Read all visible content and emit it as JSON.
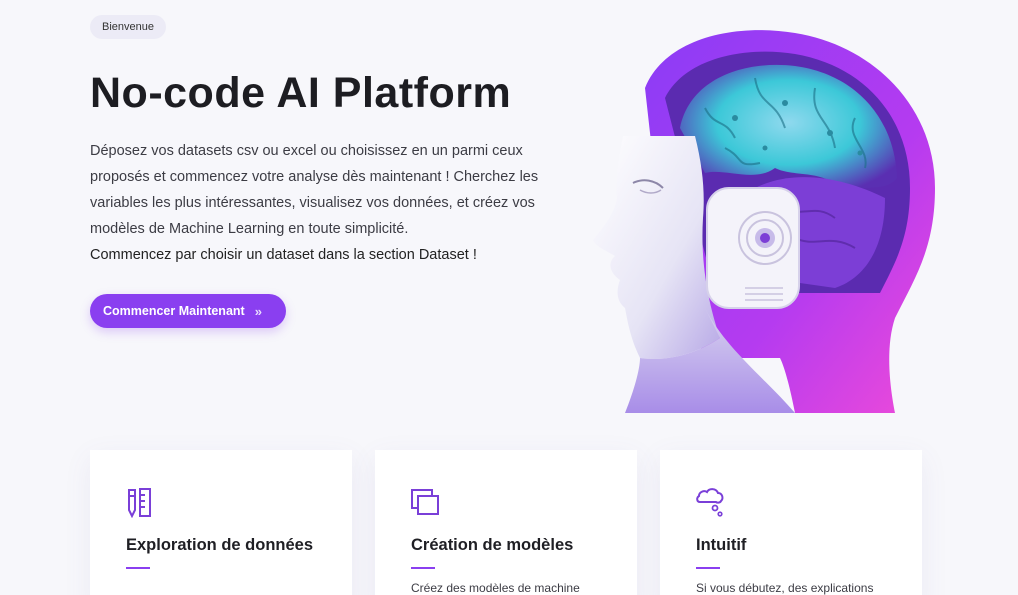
{
  "hero": {
    "badge": "Bienvenue",
    "title": "No-code AI Platform",
    "description": "Déposez vos datasets csv ou excel ou choisissez en un parmi ceux proposés et commencez votre analyse dès maintenant ! Cherchez les variables les plus intéressantes, visualisez vos données, et créez vos modèles de Machine Learning en toute simplicité.",
    "call_to_action_text": "Commencez par choisir un dataset dans la section Dataset !",
    "button_label": "Commencer Maintenant",
    "button_icon": "double-chevron-right-icon",
    "illustration": "ai-head-illustration"
  },
  "features": [
    {
      "title": "Exploration de données",
      "text": "",
      "icon": "ruler-pencil-icon"
    },
    {
      "title": "Création de modèles",
      "text": "Créez des modèles de machine",
      "icon": "stacked-squares-icon"
    },
    {
      "title": "Intuitif",
      "text": "Si vous débutez, des explications",
      "icon": "thought-cloud-icon"
    }
  ],
  "colors": {
    "accent": "#8a3ff0",
    "background": "#f7f7fb",
    "badge_bg": "#ecebf6"
  }
}
